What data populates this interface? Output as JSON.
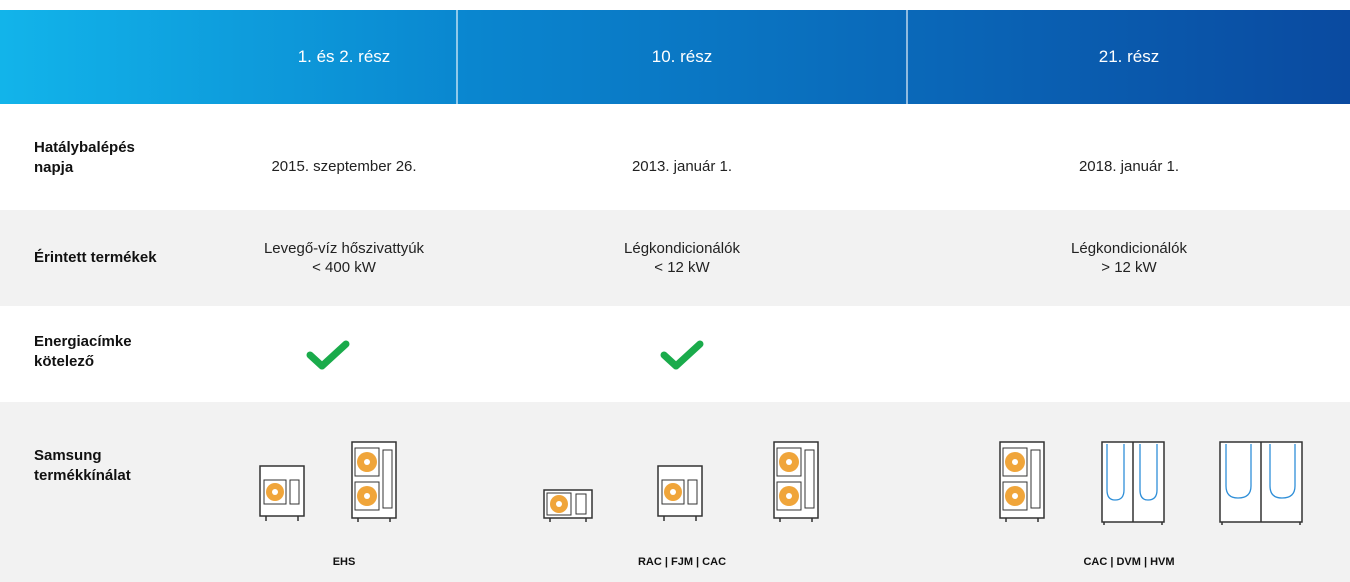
{
  "header": {
    "columns": [
      "1. és 2. rész",
      "10. rész",
      "21. rész"
    ]
  },
  "rows": {
    "effective_date": {
      "label_line1": "Hatálybalépés",
      "label_line2": "napja",
      "values": [
        "2015. szeptember 26.",
        "2013. január 1.",
        "2018. január 1."
      ]
    },
    "affected_products": {
      "label": "Érintett termékek",
      "values": [
        {
          "line1": "Levegő-víz hőszivattyúk",
          "line2": "< 400 kW"
        },
        {
          "line1": "Légkondicionálók",
          "line2": "< 12 kW"
        },
        {
          "line1": "Légkondicionálók",
          "line2": "> 12 kW"
        }
      ]
    },
    "energy_label": {
      "label_line1": "Energiacímke",
      "label_line2": "kötelező",
      "checks": [
        true,
        true,
        false
      ],
      "check_color": "#1aab4b"
    },
    "samsung_range": {
      "label_line1": "Samsung",
      "label_line2": "termékkínálat",
      "captions": [
        "EHS",
        "RAC | FJM | CAC",
        "CAC | DVM | HVM"
      ]
    }
  },
  "colors": {
    "header_start": "#12b4ea",
    "header_end": "#0a4aa0",
    "row_shade": "#f2f2f2",
    "fan_orange": "#f0a53a",
    "duct_blue": "#2f8fd8"
  }
}
